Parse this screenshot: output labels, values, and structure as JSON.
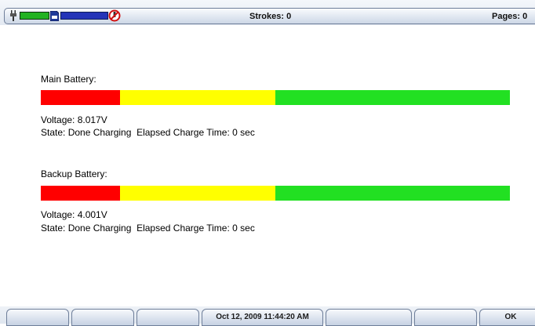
{
  "status_bar": {
    "strokes_text": "Strokes: 0",
    "pages_text": "Pages: 0",
    "icons": [
      "power-plug-icon",
      "battery-level-icon",
      "sd-card-icon",
      "memory-level-icon",
      "no-entry-icon"
    ],
    "battery_fill": 1.0,
    "memory_fill": 1.0
  },
  "main_battery": {
    "title": "Main Battery:",
    "voltage_text": "Voltage: 8.017V",
    "state_text": "State: Done Charging  Elapsed Charge Time: 0 sec"
  },
  "backup_battery": {
    "title": "Backup Battery:",
    "voltage_text": "Voltage: 4.001V",
    "state_text": "State: Done Charging  Elapsed Charge Time: 0 sec"
  },
  "bar_colors": {
    "red": "#ff0000",
    "yellow": "#ffff00",
    "green": "#22e022"
  },
  "footer": {
    "datetime": "Oct 12, 2009  11:44:20 AM",
    "ok_label": "OK"
  }
}
